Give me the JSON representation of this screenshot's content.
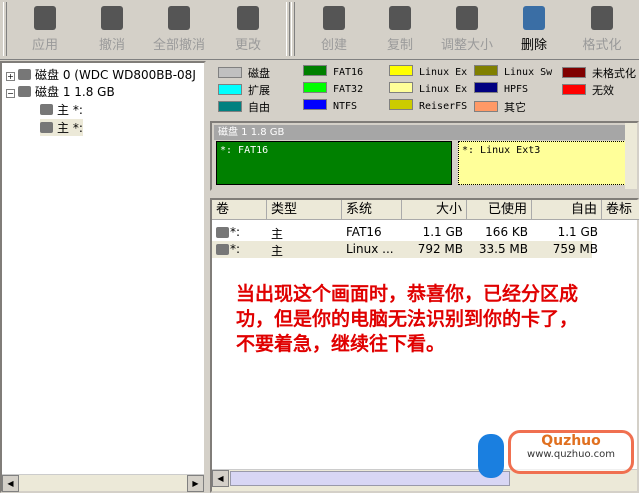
{
  "toolbar": {
    "items": [
      {
        "label": "应用",
        "icon": "apply-icon",
        "enabled": false
      },
      {
        "label": "撤消",
        "icon": "undo-icon",
        "enabled": false
      },
      {
        "label": "全部撤消",
        "icon": "undo-all-icon",
        "enabled": false
      },
      {
        "label": "更改",
        "icon": "change-icon",
        "enabled": false
      },
      {
        "label": "创建",
        "icon": "create-icon",
        "enabled": false
      },
      {
        "label": "复制",
        "icon": "copy-icon",
        "enabled": false
      },
      {
        "label": "调整大小",
        "icon": "resize-icon",
        "enabled": false
      },
      {
        "label": "删除",
        "icon": "delete-icon",
        "enabled": true
      },
      {
        "label": "格式化",
        "icon": "format-icon",
        "enabled": false
      }
    ]
  },
  "tree": {
    "disk0": "磁盘 0 (WDC WD800BB-08J",
    "disk1": "磁盘 1 1.8 GB",
    "parts": [
      "主 *:",
      "主 *:"
    ]
  },
  "legend": [
    {
      "label": "磁盘",
      "color": "#c0c0c0"
    },
    {
      "label": "扩展",
      "color": "#00ffff"
    },
    {
      "label": "自由",
      "color": "#008080"
    },
    {
      "label": "FAT16",
      "color": "#008000"
    },
    {
      "label": "FAT32",
      "color": "#00ff00"
    },
    {
      "label": "NTFS",
      "color": "#0000ff"
    },
    {
      "label": "Linux Ex",
      "color": "#ffff00"
    },
    {
      "label": "Linux Ex",
      "color": "#ffff99"
    },
    {
      "label": "ReiserFS",
      "color": "#cccc00"
    },
    {
      "label": "Linux Sw",
      "color": "#808000"
    },
    {
      "label": "HPFS",
      "color": "#000080"
    },
    {
      "label": "其它",
      "color": "#ff9966"
    },
    {
      "label": "未格式化",
      "color": "#800000"
    },
    {
      "label": "无效",
      "color": "#ff0000"
    }
  ],
  "map": {
    "title": "磁盘 1 1.8 GB",
    "parts": [
      {
        "label": "*: FAT16",
        "color": "#008000"
      },
      {
        "label": "*: Linux Ext3",
        "color": "#ffff99"
      }
    ]
  },
  "table": {
    "headers": [
      "卷",
      "类型",
      "系统",
      "大小",
      "已使用",
      "自由",
      "卷标"
    ],
    "rows": [
      [
        "*:",
        "主",
        "FAT16",
        "1.1 GB",
        "166 KB",
        "1.1 GB",
        ""
      ],
      [
        "*:",
        "主",
        "Linux ...",
        "792 MB",
        "33.5 MB",
        "759 MB",
        ""
      ]
    ]
  },
  "note": "当出现这个画面时，恭喜你，已经分区成功，但是你的电脑无法识别到你的卡了，不要着急，继续往下看。",
  "watermark": {
    "brand": "Quzhuo",
    "url": "www.quzhuo.com"
  }
}
